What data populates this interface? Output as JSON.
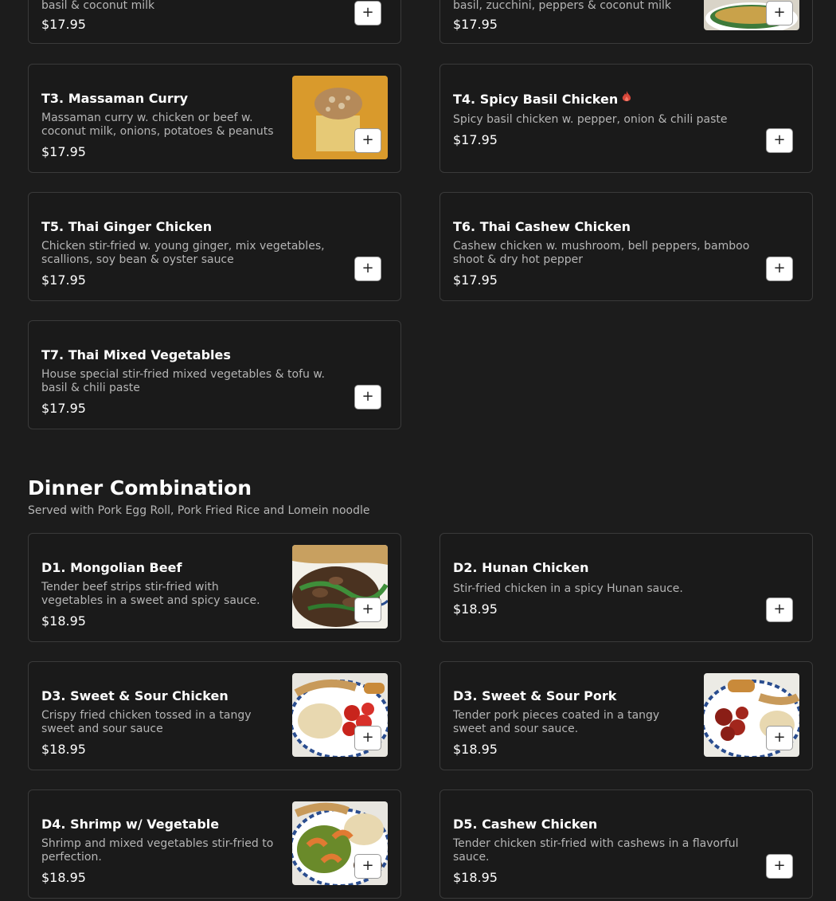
{
  "thai": {
    "items": [
      {
        "desc_tail": "basil & coconut milk",
        "price": "$17.95",
        "add": "+"
      },
      {
        "desc_tail": "basil, zucchini, peppers & coconut milk",
        "price": "$17.95",
        "add": "+",
        "image": "green-curry-bowl"
      },
      {
        "title": "T3. Massaman Curry",
        "desc": "Massaman curry w. chicken or beef w. coconut milk, onions, potatoes & peanuts",
        "price": "$17.95",
        "add": "+",
        "image": "massaman-curry-bowl"
      },
      {
        "title": "T4. Spicy Basil Chicken",
        "desc": "Spicy basil chicken w. pepper, onion & chili paste",
        "price": "$17.95",
        "add": "+",
        "spicy_icon": "flame-icon"
      },
      {
        "title": "T5. Thai Ginger Chicken",
        "desc": "Chicken stir-fried w. young ginger, mix vegetables, scallions, soy bean & oyster sauce",
        "price": "$17.95",
        "add": "+"
      },
      {
        "title": "T6. Thai Cashew Chicken",
        "desc": "Cashew chicken w. mushroom, bell peppers, bamboo shoot & dry hot pepper",
        "price": "$17.95",
        "add": "+"
      },
      {
        "title": "T7. Thai Mixed Vegetables",
        "desc": "House special stir-fried mixed vegetables & tofu w. basil & chili paste",
        "price": "$17.95",
        "add": "+"
      }
    ]
  },
  "dinner": {
    "title": "Dinner Combination",
    "subtitle": "Served with Pork Egg Roll, Pork Fried Rice and Lomein noodle",
    "items": [
      {
        "title": "D1. Mongolian Beef",
        "desc": "Tender beef strips stir-fried with vegetables in a sweet and spicy sauce.",
        "price": "$18.95",
        "add": "+",
        "image": "mongolian-beef-plate"
      },
      {
        "title": "D2. Hunan Chicken",
        "desc": "Stir-fried chicken in a spicy Hunan sauce.",
        "price": "$18.95",
        "add": "+"
      },
      {
        "title": "D3. Sweet & Sour Chicken",
        "desc": "Crispy fried chicken tossed in a tangy sweet and sour sauce",
        "price": "$18.95",
        "add": "+",
        "image": "sweet-sour-chicken-plate"
      },
      {
        "title": "D3. Sweet & Sour Pork",
        "desc": "Tender pork pieces coated in a tangy sweet and sour sauce.",
        "price": "$18.95",
        "add": "+",
        "image": "sweet-sour-pork-plate"
      },
      {
        "title": "D4. Shrimp w/ Vegetable",
        "desc": "Shrimp and mixed vegetables stir-fried to perfection.",
        "price": "$18.95",
        "add": "+",
        "image": "shrimp-vegetable-plate"
      },
      {
        "title": "D5. Cashew Chicken",
        "desc": "Tender chicken stir-fried with cashews in a flavorful sauce.",
        "price": "$18.95",
        "add": "+"
      }
    ]
  },
  "colors": {
    "background": "#1c1c1c",
    "card_border": "#3a3a3a",
    "text_muted": "#b5b5b5",
    "spicy": "#d9473a"
  }
}
